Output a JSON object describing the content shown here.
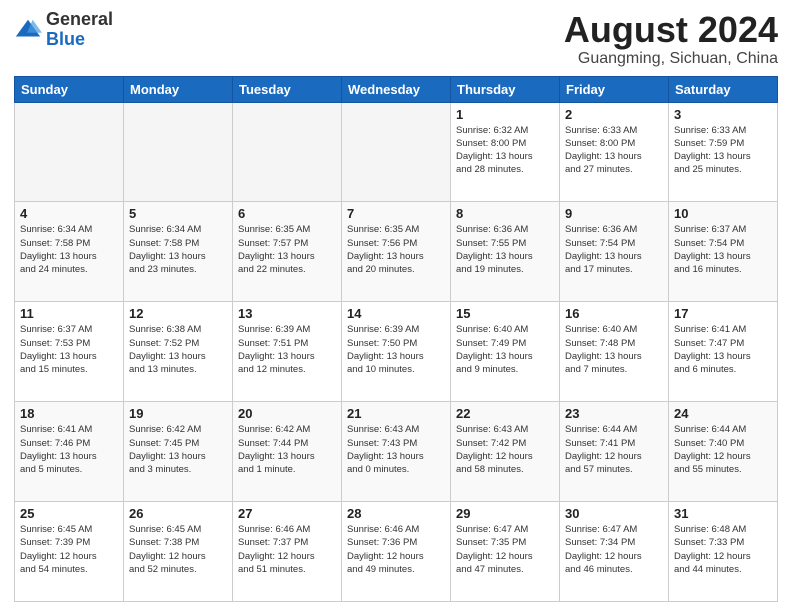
{
  "logo": {
    "general": "General",
    "blue": "Blue"
  },
  "header": {
    "month": "August 2024",
    "location": "Guangming, Sichuan, China"
  },
  "weekdays": [
    "Sunday",
    "Monday",
    "Tuesday",
    "Wednesday",
    "Thursday",
    "Friday",
    "Saturday"
  ],
  "weeks": [
    [
      {
        "day": "",
        "info": ""
      },
      {
        "day": "",
        "info": ""
      },
      {
        "day": "",
        "info": ""
      },
      {
        "day": "",
        "info": ""
      },
      {
        "day": "1",
        "info": "Sunrise: 6:32 AM\nSunset: 8:00 PM\nDaylight: 13 hours\nand 28 minutes."
      },
      {
        "day": "2",
        "info": "Sunrise: 6:33 AM\nSunset: 8:00 PM\nDaylight: 13 hours\nand 27 minutes."
      },
      {
        "day": "3",
        "info": "Sunrise: 6:33 AM\nSunset: 7:59 PM\nDaylight: 13 hours\nand 25 minutes."
      }
    ],
    [
      {
        "day": "4",
        "info": "Sunrise: 6:34 AM\nSunset: 7:58 PM\nDaylight: 13 hours\nand 24 minutes."
      },
      {
        "day": "5",
        "info": "Sunrise: 6:34 AM\nSunset: 7:58 PM\nDaylight: 13 hours\nand 23 minutes."
      },
      {
        "day": "6",
        "info": "Sunrise: 6:35 AM\nSunset: 7:57 PM\nDaylight: 13 hours\nand 22 minutes."
      },
      {
        "day": "7",
        "info": "Sunrise: 6:35 AM\nSunset: 7:56 PM\nDaylight: 13 hours\nand 20 minutes."
      },
      {
        "day": "8",
        "info": "Sunrise: 6:36 AM\nSunset: 7:55 PM\nDaylight: 13 hours\nand 19 minutes."
      },
      {
        "day": "9",
        "info": "Sunrise: 6:36 AM\nSunset: 7:54 PM\nDaylight: 13 hours\nand 17 minutes."
      },
      {
        "day": "10",
        "info": "Sunrise: 6:37 AM\nSunset: 7:54 PM\nDaylight: 13 hours\nand 16 minutes."
      }
    ],
    [
      {
        "day": "11",
        "info": "Sunrise: 6:37 AM\nSunset: 7:53 PM\nDaylight: 13 hours\nand 15 minutes."
      },
      {
        "day": "12",
        "info": "Sunrise: 6:38 AM\nSunset: 7:52 PM\nDaylight: 13 hours\nand 13 minutes."
      },
      {
        "day": "13",
        "info": "Sunrise: 6:39 AM\nSunset: 7:51 PM\nDaylight: 13 hours\nand 12 minutes."
      },
      {
        "day": "14",
        "info": "Sunrise: 6:39 AM\nSunset: 7:50 PM\nDaylight: 13 hours\nand 10 minutes."
      },
      {
        "day": "15",
        "info": "Sunrise: 6:40 AM\nSunset: 7:49 PM\nDaylight: 13 hours\nand 9 minutes."
      },
      {
        "day": "16",
        "info": "Sunrise: 6:40 AM\nSunset: 7:48 PM\nDaylight: 13 hours\nand 7 minutes."
      },
      {
        "day": "17",
        "info": "Sunrise: 6:41 AM\nSunset: 7:47 PM\nDaylight: 13 hours\nand 6 minutes."
      }
    ],
    [
      {
        "day": "18",
        "info": "Sunrise: 6:41 AM\nSunset: 7:46 PM\nDaylight: 13 hours\nand 5 minutes."
      },
      {
        "day": "19",
        "info": "Sunrise: 6:42 AM\nSunset: 7:45 PM\nDaylight: 13 hours\nand 3 minutes."
      },
      {
        "day": "20",
        "info": "Sunrise: 6:42 AM\nSunset: 7:44 PM\nDaylight: 13 hours\nand 1 minute."
      },
      {
        "day": "21",
        "info": "Sunrise: 6:43 AM\nSunset: 7:43 PM\nDaylight: 13 hours\nand 0 minutes."
      },
      {
        "day": "22",
        "info": "Sunrise: 6:43 AM\nSunset: 7:42 PM\nDaylight: 12 hours\nand 58 minutes."
      },
      {
        "day": "23",
        "info": "Sunrise: 6:44 AM\nSunset: 7:41 PM\nDaylight: 12 hours\nand 57 minutes."
      },
      {
        "day": "24",
        "info": "Sunrise: 6:44 AM\nSunset: 7:40 PM\nDaylight: 12 hours\nand 55 minutes."
      }
    ],
    [
      {
        "day": "25",
        "info": "Sunrise: 6:45 AM\nSunset: 7:39 PM\nDaylight: 12 hours\nand 54 minutes."
      },
      {
        "day": "26",
        "info": "Sunrise: 6:45 AM\nSunset: 7:38 PM\nDaylight: 12 hours\nand 52 minutes."
      },
      {
        "day": "27",
        "info": "Sunrise: 6:46 AM\nSunset: 7:37 PM\nDaylight: 12 hours\nand 51 minutes."
      },
      {
        "day": "28",
        "info": "Sunrise: 6:46 AM\nSunset: 7:36 PM\nDaylight: 12 hours\nand 49 minutes."
      },
      {
        "day": "29",
        "info": "Sunrise: 6:47 AM\nSunset: 7:35 PM\nDaylight: 12 hours\nand 47 minutes."
      },
      {
        "day": "30",
        "info": "Sunrise: 6:47 AM\nSunset: 7:34 PM\nDaylight: 12 hours\nand 46 minutes."
      },
      {
        "day": "31",
        "info": "Sunrise: 6:48 AM\nSunset: 7:33 PM\nDaylight: 12 hours\nand 44 minutes."
      }
    ]
  ]
}
